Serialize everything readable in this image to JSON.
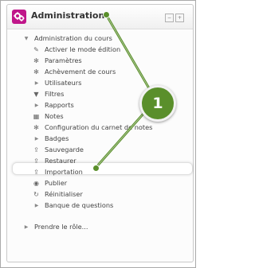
{
  "block": {
    "title": "Administration",
    "icon": "settings-block-icon",
    "controls": [
      "−",
      "+"
    ]
  },
  "menu": [
    {
      "label": "Administration du cours",
      "icon": "expand-arrow",
      "level": 0
    },
    {
      "label": "Activer le mode édition",
      "icon": "pencil-icon",
      "level": 1
    },
    {
      "label": "Paramètres",
      "icon": "gear-icon",
      "level": 1
    },
    {
      "label": "Achèvement de cours",
      "icon": "gear-icon",
      "level": 1
    },
    {
      "label": "Utilisateurs",
      "icon": "collapsed-arrow",
      "level": 1
    },
    {
      "label": "Filtres",
      "icon": "filter-icon",
      "level": 1
    },
    {
      "label": "Rapports",
      "icon": "collapsed-arrow",
      "level": 1
    },
    {
      "label": "Notes",
      "icon": "grades-table-icon",
      "level": 1
    },
    {
      "label": "Configuration du carnet de notes",
      "icon": "gear-icon",
      "level": 1
    },
    {
      "label": "Badges",
      "icon": "collapsed-arrow",
      "level": 1
    },
    {
      "label": "Sauvegarde",
      "icon": "backup-upload-icon",
      "level": 1
    },
    {
      "label": "Restaurer",
      "icon": "restore-icon",
      "level": 1
    },
    {
      "label": "Importation",
      "icon": "import-icon",
      "level": 1
    },
    {
      "label": "Publier",
      "icon": "publish-icon",
      "level": 1
    },
    {
      "label": "Réinitialiser",
      "icon": "reset-icon",
      "level": 1
    },
    {
      "label": "Banque de questions",
      "icon": "collapsed-arrow",
      "level": 1
    },
    {
      "label": "Prendre le rôle...",
      "icon": "collapsed-arrow",
      "level": 0
    }
  ],
  "callout": {
    "number": "1",
    "color": "#5a8f2b"
  }
}
